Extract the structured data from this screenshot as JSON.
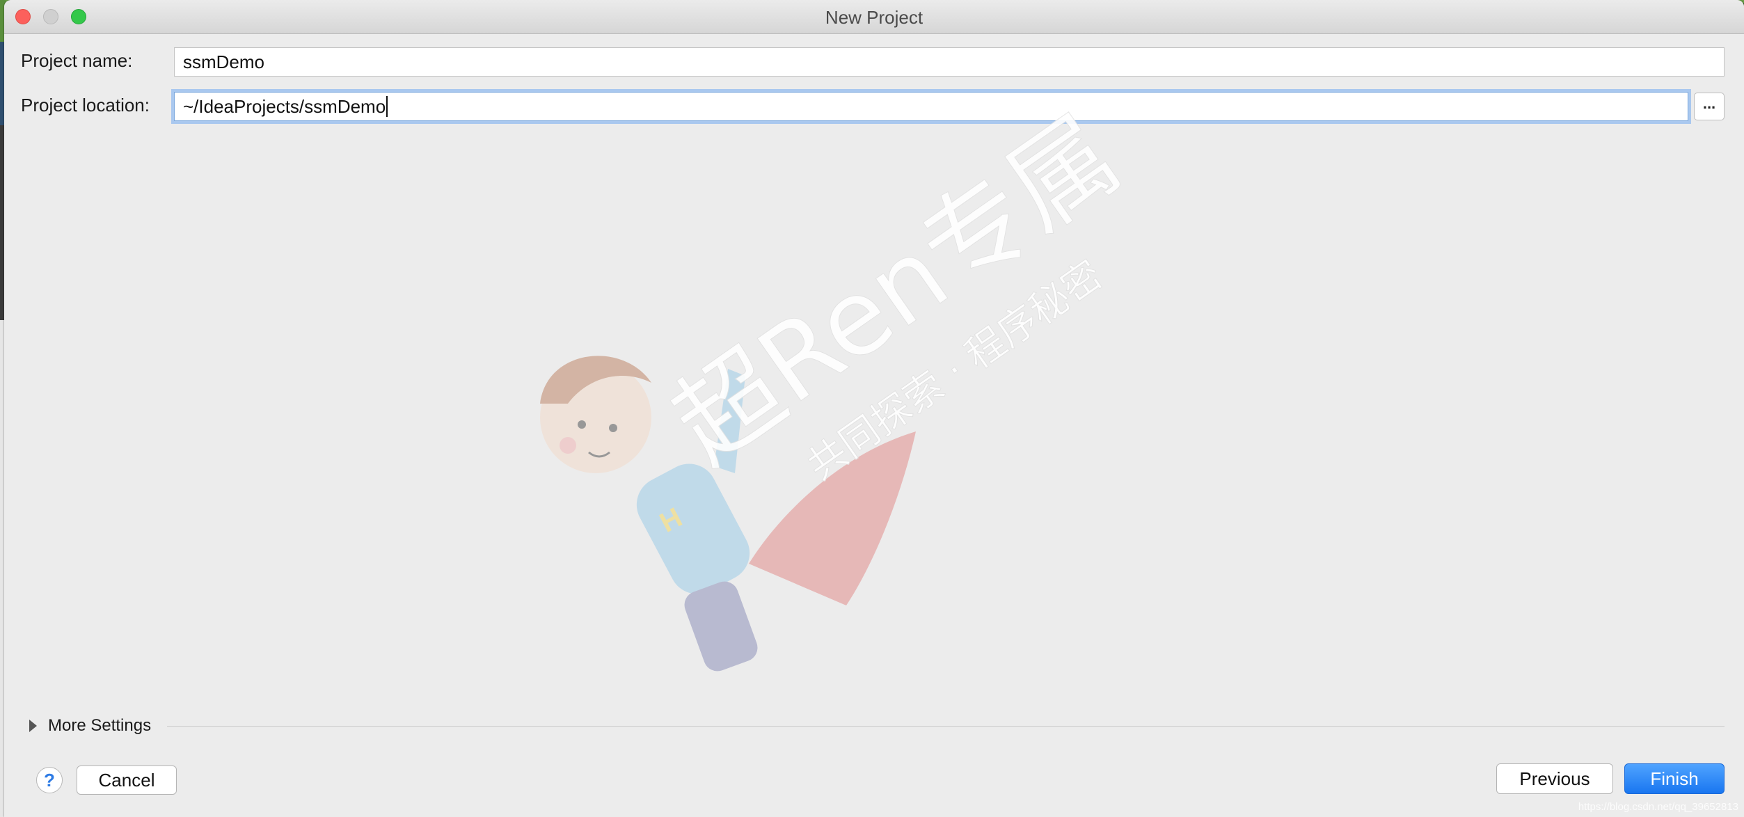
{
  "window": {
    "title": "New Project"
  },
  "form": {
    "name_label": "Project name:",
    "name_value": "ssmDemo",
    "location_label": "Project location:",
    "location_value": "~/IdeaProjects/ssmDemo",
    "browse_label": "..."
  },
  "more_settings": {
    "label": "More Settings",
    "expanded": false
  },
  "buttons": {
    "help": "?",
    "cancel": "Cancel",
    "previous": "Previous",
    "finish": "Finish"
  },
  "watermark": {
    "main": "超Ren专属",
    "sub": "共同探索 · 程序秘密"
  },
  "footer_credit": "https://blog.csdn.net/qq_39652813",
  "colors": {
    "accent": "#1976f0",
    "focus_ring": "#a9c8ef",
    "window_bg": "#ececec"
  }
}
